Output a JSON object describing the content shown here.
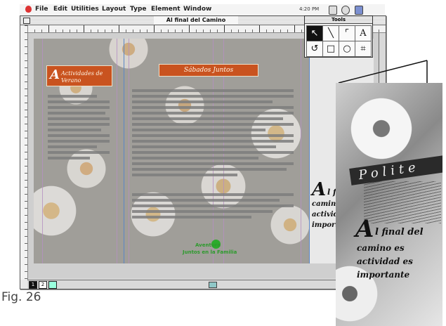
{
  "menu": {
    "items": [
      "File",
      "Edit",
      "Utilities",
      "Layout",
      "Type",
      "Element",
      "Window"
    ],
    "clock": "4:20 PM"
  },
  "document": {
    "title": "Al final del Camino",
    "page_numbers": [
      "1",
      "2"
    ]
  },
  "spread": {
    "left_heading": [
      "Actividades de",
      "Verano"
    ],
    "center_heading": "Sábados Juntos",
    "logo_line1": "Aventura",
    "logo_line2": "Juntos en la Familia"
  },
  "cover_preview": {
    "large_letter": "A",
    "lines": [
      "l final",
      "camino e",
      "actividade",
      "importante"
    ]
  },
  "toolbox": {
    "title": "Tools",
    "tools": [
      "pointer",
      "line",
      "orthogonal-line",
      "text",
      "rotate",
      "rectangle",
      "ellipse",
      "crop"
    ]
  },
  "callout": {
    "banner": "Polite",
    "large_letter": "A",
    "lines": [
      "l final del",
      "camino es",
      "actividad es",
      "importante"
    ]
  },
  "caption": "Fig. 26"
}
